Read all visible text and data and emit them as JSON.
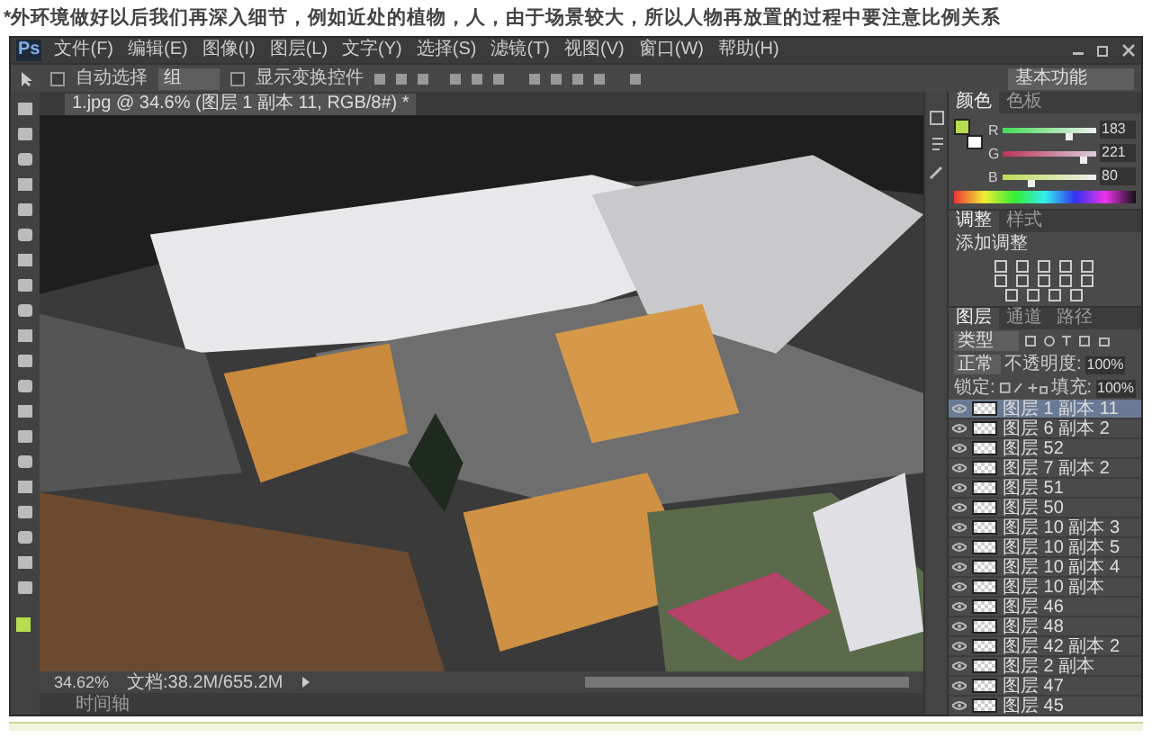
{
  "caption": "*外环境做好以后我们再深入细节，例如近处的植物，人，由于场景较大，所以人物再放置的过程中要注意比例关系",
  "app": {
    "logo": "Ps",
    "menu": [
      "文件(F)",
      "编辑(E)",
      "图像(I)",
      "图层(L)",
      "文字(Y)",
      "选择(S)",
      "滤镜(T)",
      "视图(V)",
      "窗口(W)",
      "帮助(H)"
    ]
  },
  "options_bar": {
    "auto_select": {
      "label": "自动选择",
      "checked": false
    },
    "target": "组",
    "show_transform": {
      "label": "显示变换控件",
      "checked": false
    },
    "workspace": "基本功能"
  },
  "document_tab": {
    "title": "1.jpg @ 34.6% (图层 1 副本 11, RGB/8#) *"
  },
  "status_bar": {
    "zoom": "34.62%",
    "doc_size": "文档:38.2M/655.2M"
  },
  "timeline_tab": "时间轴",
  "color_panel": {
    "tabs": [
      {
        "label": "颜色",
        "selected": true
      },
      {
        "label": "色板",
        "selected": false
      }
    ],
    "channels": [
      {
        "name": "R",
        "level": 0.72,
        "reading": "183"
      },
      {
        "name": "G",
        "level": 0.87,
        "reading": "221"
      },
      {
        "name": "B",
        "level": 0.31,
        "reading": "80"
      }
    ]
  },
  "adjustments_panel": {
    "tabs": [
      {
        "label": "调整",
        "selected": true
      },
      {
        "label": "样式",
        "selected": false
      }
    ],
    "heading": "添加调整"
  },
  "layers_panel": {
    "tabs": [
      {
        "label": "图层",
        "selected": true
      },
      {
        "label": "通道",
        "selected": false
      },
      {
        "label": "路径",
        "selected": false
      }
    ],
    "filter": "类型",
    "blend_mode": "正常",
    "opacity_label": "不透明度:",
    "opacity": "100%",
    "lock_label": "锁定:",
    "fill_label": "填充:",
    "fill": "100%",
    "layers": [
      {
        "name": "图层 1 副本 11",
        "selected": true,
        "visible": true
      },
      {
        "name": "图层 6 副本 2",
        "selected": false,
        "visible": true
      },
      {
        "name": "图层 52",
        "selected": false,
        "visible": true
      },
      {
        "name": "图层 7 副本 2",
        "selected": false,
        "visible": true
      },
      {
        "name": "图层 51",
        "selected": false,
        "visible": true
      },
      {
        "name": "图层 50",
        "selected": false,
        "visible": true
      },
      {
        "name": "图层 10 副本 3",
        "selected": false,
        "visible": true
      },
      {
        "name": "图层 10 副本 5",
        "selected": false,
        "visible": true
      },
      {
        "name": "图层 10 副本 4",
        "selected": false,
        "visible": true
      },
      {
        "name": "图层 10 副本",
        "selected": false,
        "visible": true
      },
      {
        "name": "图层 46",
        "selected": false,
        "visible": true
      },
      {
        "name": "图层 48",
        "selected": false,
        "visible": true
      },
      {
        "name": "图层 42 副本 2",
        "selected": false,
        "visible": true
      },
      {
        "name": "图层 2 副本",
        "selected": false,
        "visible": true
      },
      {
        "name": "图层 47",
        "selected": false,
        "visible": true
      },
      {
        "name": "图层 45",
        "selected": false,
        "visible": true
      }
    ]
  }
}
